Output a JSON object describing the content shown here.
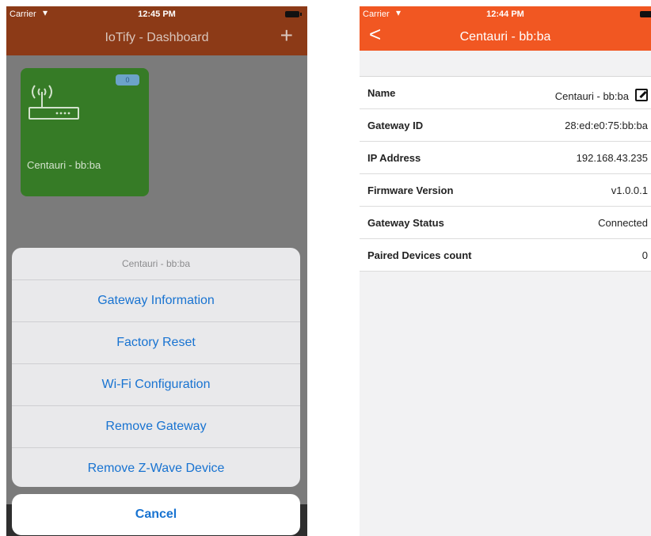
{
  "left": {
    "status": {
      "carrier": "Carrier",
      "time": "12:45 PM"
    },
    "header": {
      "title": "IoTify - Dashboard",
      "add_label": "+"
    },
    "gateway_tile": {
      "badge": "0",
      "name": "Centauri - bb:ba"
    },
    "action_sheet": {
      "title": "Centauri - bb:ba",
      "items": [
        {
          "label": "Gateway Information"
        },
        {
          "label": "Factory Reset"
        },
        {
          "label": "Wi-Fi Configuration"
        },
        {
          "label": "Remove Gateway"
        },
        {
          "label": "Remove Z-Wave Device"
        }
      ],
      "cancel": "Cancel"
    }
  },
  "right": {
    "status": {
      "carrier": "Carrier",
      "time": "12:44 PM"
    },
    "header": {
      "title": "Centauri - bb:ba",
      "back_label": "<"
    },
    "rows": [
      {
        "label": "Name",
        "value": "Centauri - bb:ba"
      },
      {
        "label": "Gateway ID",
        "value": "28:ed:e0:75:bb:ba"
      },
      {
        "label": "IP Address",
        "value": "192.168.43.235"
      },
      {
        "label": "Firmware Version",
        "value": "v1.0.0.1"
      },
      {
        "label": "Gateway Status",
        "value": "Connected"
      },
      {
        "label": "Paired Devices count",
        "value": "0"
      }
    ]
  },
  "colors": {
    "left_header": "#8c3a17",
    "right_header": "#f15722",
    "tile_green": "#367b26",
    "action_blue": "#1873d1"
  }
}
